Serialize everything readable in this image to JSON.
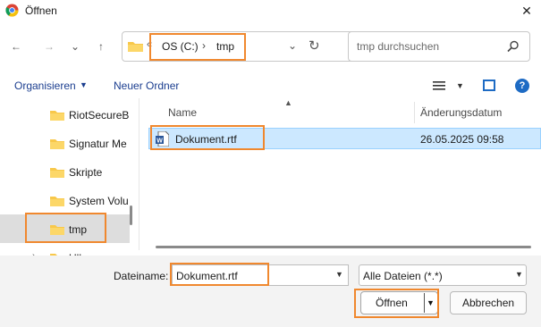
{
  "window": {
    "title": "Öffnen",
    "close_glyph": "✕"
  },
  "nav": {
    "back_glyph": "←",
    "forward_glyph": "→",
    "recent_glyph": "⌄",
    "up_glyph": "↑"
  },
  "address": {
    "overflow_glyph": "«",
    "segments": [
      "OS (C:)",
      "tmp"
    ],
    "separator": "›",
    "dropdown_glyph": "⌄",
    "refresh_glyph": "↻"
  },
  "search": {
    "placeholder": "tmp durchsuchen"
  },
  "toolbar": {
    "organize_label": "Organisieren",
    "new_folder_label": "Neuer Ordner",
    "help_label": "?"
  },
  "sidebar": {
    "items": [
      {
        "label": "RiotSecureB"
      },
      {
        "label": "Signatur Me"
      },
      {
        "label": "Skripte"
      },
      {
        "label": "System Volu"
      },
      {
        "label": "tmp"
      },
      {
        "label": "Ulla"
      }
    ]
  },
  "list": {
    "columns": [
      "Name",
      "Änderungsdatum"
    ],
    "rows": [
      {
        "name": "Dokument.rtf",
        "date": "26.05.2025 09:58"
      }
    ]
  },
  "footer": {
    "filename_label": "Dateiname:",
    "filename_value": "Dokument.rtf",
    "filter_value": "Alle Dateien (*.*)",
    "open_label": "Öffnen",
    "cancel_label": "Abbrechen"
  },
  "colors": {
    "highlight": "#f0882e",
    "selection": "#cce8ff",
    "folder": "#f8c84a",
    "accent": "#1e6bc4"
  }
}
